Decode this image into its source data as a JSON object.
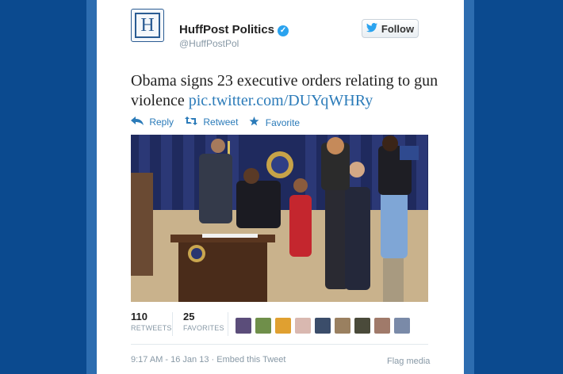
{
  "author": {
    "name": "HuffPost Politics",
    "handle": "@HuffPostPol",
    "avatar_letter": "H",
    "verified_icon": "verified-badge-icon"
  },
  "follow_button": {
    "label": "Follow",
    "icon": "twitter-bird-icon"
  },
  "tweet": {
    "text": "Obama signs 23 executive orders relating to gun violence ",
    "link": "pic.twitter.com/DUYqWHRy"
  },
  "actions": [
    {
      "label": "Reply",
      "icon": "reply-arrow-icon"
    },
    {
      "label": "Retweet",
      "icon": "retweet-icon"
    },
    {
      "label": "Favorite",
      "icon": "star-icon"
    }
  ],
  "media": {
    "description_icon": "photo"
  },
  "stats": {
    "retweets": {
      "count": "110",
      "label": "RETWEETS"
    },
    "favorites": {
      "count": "25",
      "label": "FAVORITES"
    }
  },
  "meta": {
    "timestamp": "9:17 AM - 16 Jan 13",
    "separator": " · ",
    "embed": "Embed this Tweet"
  },
  "flag": "Flag media",
  "colors": {
    "background": "#0b4a8f",
    "link": "#2b7bb9",
    "accent": "#2aa3ef"
  }
}
